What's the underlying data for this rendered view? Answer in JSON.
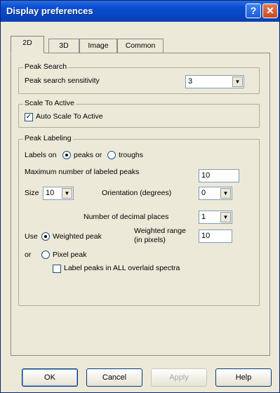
{
  "window": {
    "title": "Display preferences",
    "help_symbol": "?",
    "close_symbol": "✕"
  },
  "tabs": [
    {
      "label": "2D"
    },
    {
      "label": "3D"
    },
    {
      "label": "Image"
    },
    {
      "label": "Common"
    }
  ],
  "peak_search": {
    "title": "Peak Search",
    "sensitivity_label": "Peak search sensitivity",
    "sensitivity_value": "3"
  },
  "scale_to_active": {
    "title": "Scale To Active",
    "auto_scale_label": "Auto Scale To Active",
    "auto_scale_checked": true
  },
  "peak_labeling": {
    "title": "Peak Labeling",
    "labels_on_label": "Labels on",
    "peaks_or_label": "peaks or",
    "troughs_label": "troughs",
    "max_labeled_label": "Maximum number of labeled peaks",
    "max_labeled_value": "10",
    "size_label": "Size",
    "size_value": "10",
    "orientation_label": "Orientation (degrees)",
    "orientation_value": "0",
    "decimal_label": "Number of decimal places",
    "decimal_value": "1",
    "use_label": "Use",
    "weighted_peak_label": "Weighted peak",
    "weighted_range_label_1": "Weighted range",
    "weighted_range_label_2": "(in pixels)",
    "weighted_range_value": "10",
    "or_label": "or",
    "pixel_peak_label": "Pixel peak",
    "overlaid_label": "Label peaks in ALL overlaid spectra",
    "overlaid_checked": false
  },
  "buttons": {
    "ok": "OK",
    "cancel": "Cancel",
    "apply": "Apply",
    "help": "Help"
  },
  "glyphs": {
    "check": "✓",
    "dropdown": "▼"
  }
}
